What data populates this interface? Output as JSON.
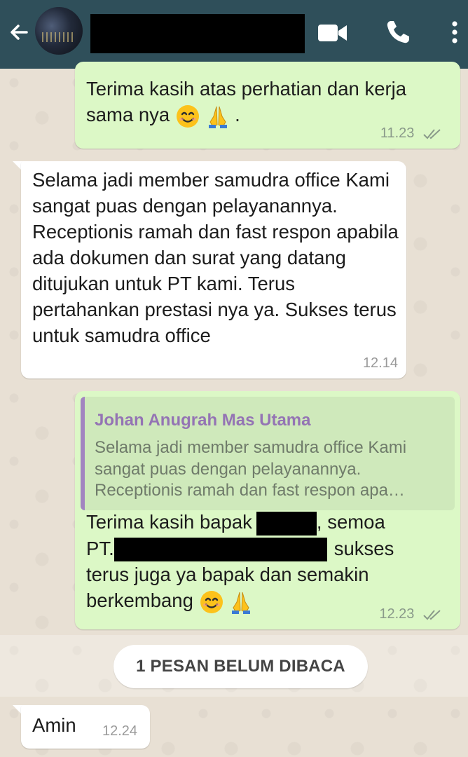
{
  "header": {
    "back_icon": "arrow-left-icon",
    "video_icon": "video-camera-icon",
    "call_icon": "phone-icon",
    "menu_icon": "more-vertical-icon",
    "bg_color": "#2f4f5a"
  },
  "messages": [
    {
      "direction": "outgoing",
      "text_a": "Terima kasih atas perhatian dan kerja",
      "text_b": "sama nya",
      "text_c": " .",
      "time": "11.23"
    },
    {
      "direction": "incoming",
      "text": "Selama jadi member samudra office Kami sangat puas dengan pelayanannya. Receptionis ramah dan fast respon apabila ada dokumen dan surat yang datang ditujukan untuk PT kami. Terus pertahankan prestasi nya ya. Sukses terus untuk samudra office",
      "time": "12.14"
    },
    {
      "direction": "outgoing",
      "quote_author": "Johan Anugrah Mas Utama",
      "quote_text": "Selama jadi member samudra office Kami sangat puas dengan pelayanannya. Receptionis ramah dan fast respon apa…",
      "text_a": "Terima kasih bapak",
      "text_b": ", semoa",
      "text_c": "PT.",
      "text_d": "sukses",
      "text_e": "terus juga ya bapak dan semakin",
      "text_f": "berkembang",
      "time": "12.23"
    },
    {
      "direction": "incoming",
      "text": "Amin",
      "time": "12.24"
    }
  ],
  "unread_banner": "1 PESAN BELUM DIBACA",
  "colors": {
    "outgoing_bubble": "#dcf8c6",
    "incoming_bubble": "#ffffff",
    "quote_accent": "#9474b4",
    "read_ticks": "#8a9a8a"
  }
}
